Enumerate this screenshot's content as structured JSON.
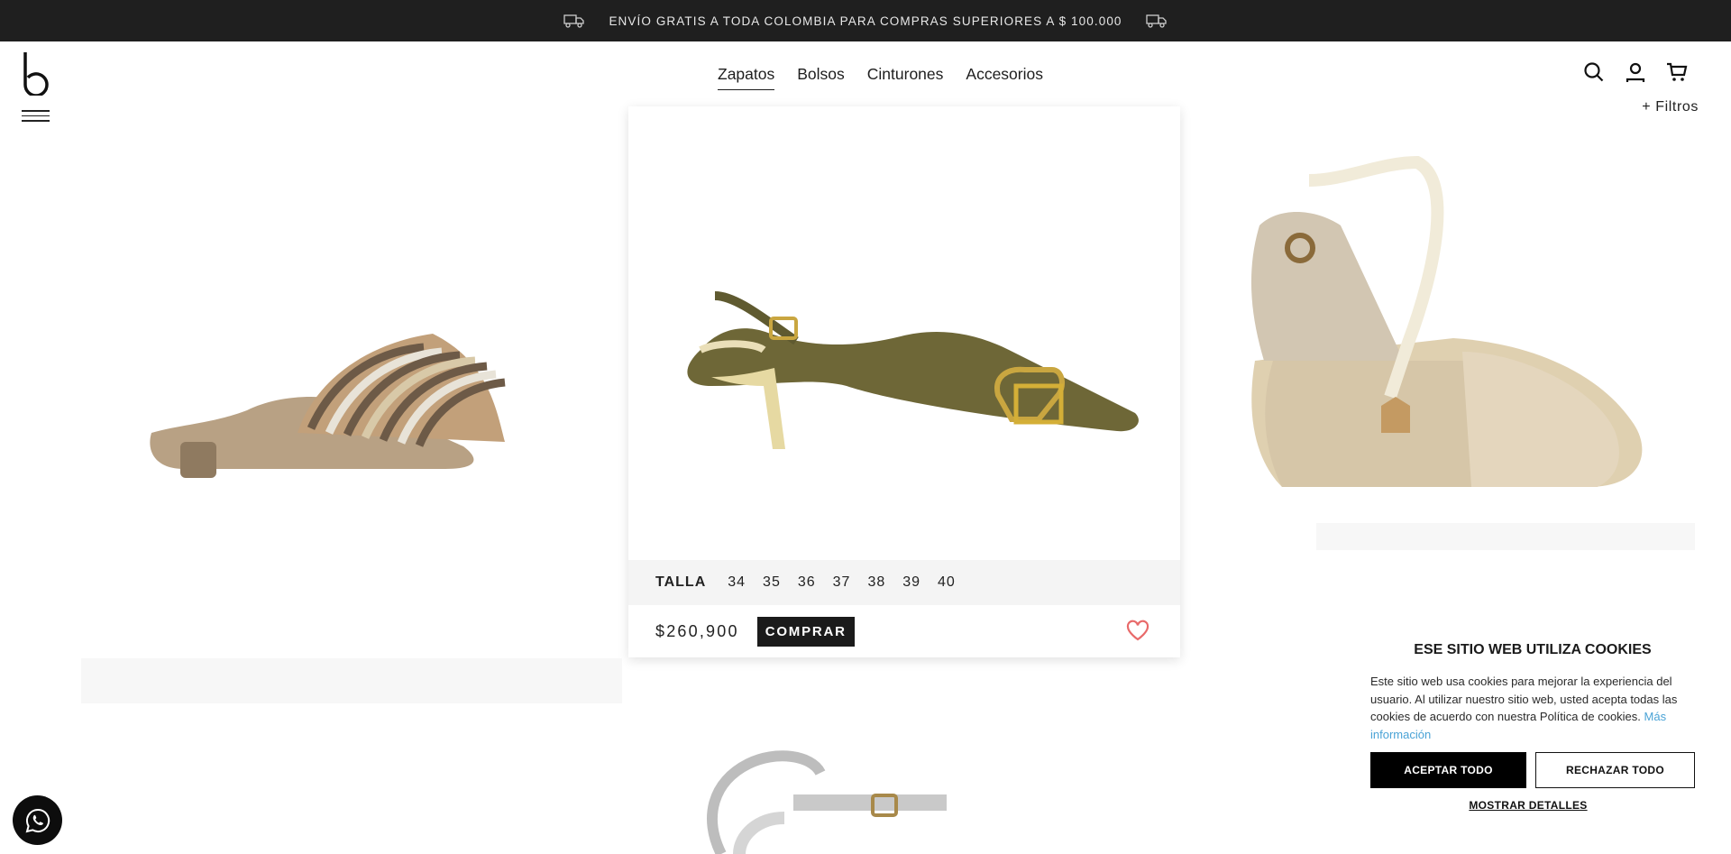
{
  "announcement": {
    "text": "ENVÍO GRATIS A TODA COLOMBIA PARA COMPRAS SUPERIORES A $ 100.000"
  },
  "nav": {
    "items": [
      {
        "label": "Zapatos",
        "active": true
      },
      {
        "label": "Bolsos"
      },
      {
        "label": "Cinturones"
      },
      {
        "label": "Accesorios"
      }
    ]
  },
  "header_icons": [
    "search-icon",
    "user-icon",
    "cart-icon"
  ],
  "filters_label": "+ Filtros",
  "product": {
    "size_label": "TALLA",
    "sizes": [
      "34",
      "35",
      "36",
      "37",
      "38",
      "39",
      "40"
    ],
    "price": "$260,900",
    "buy_label": "COMPRAR"
  },
  "cookie": {
    "title": "ESE SITIO WEB UTILIZA COOKIES",
    "text": "Este sitio web usa cookies para mejorar la experiencia del usuario. Al utilizar nuestro sitio web, usted acepta todas las cookies de acuerdo con nuestra Política de cookies.",
    "link": "Más información",
    "accept": "ACEPTAR TODO",
    "reject": "RECHAZAR TODO",
    "details": "MOSTRAR DETALLES"
  },
  "colors": {
    "announcement_bg": "#1f1f1f",
    "buy_bg": "#1b1b1b",
    "link": "#4aa3d6",
    "heart": "#e86a6a"
  }
}
